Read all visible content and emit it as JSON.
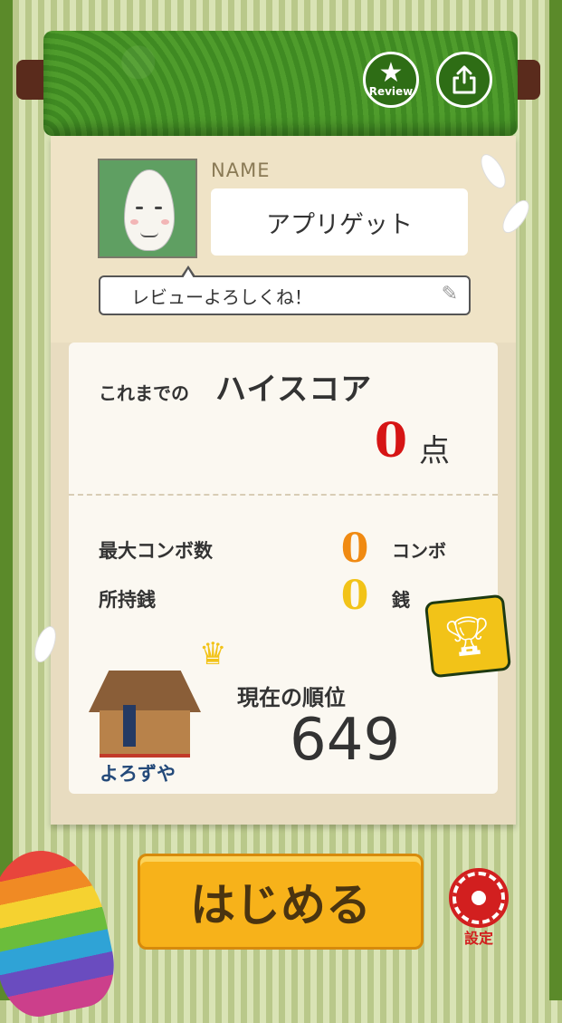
{
  "header": {
    "review_label": "Review"
  },
  "profile": {
    "name_label": "NAME",
    "name_value": "アプリゲット",
    "message": "レビューよろしくね！"
  },
  "high_score": {
    "prefix": "これまでの",
    "title": "ハイスコア",
    "value": "0",
    "unit": "点"
  },
  "stats": {
    "max_combo_label": "最大コンボ数",
    "max_combo_value": "0",
    "max_combo_unit": "コンボ",
    "money_label": "所持銭",
    "money_value": "0",
    "money_unit": "銭"
  },
  "rank": {
    "shop_name": "よろずや",
    "label": "現在の順位",
    "value": "649"
  },
  "actions": {
    "start_label": "はじめる",
    "settings_label": "設定"
  },
  "colors": {
    "score_red": "#d61515",
    "combo_orange": "#f08a12",
    "money_yellow": "#f2c318",
    "start_button": "#f7b21a",
    "settings_red": "#d21f1f"
  }
}
